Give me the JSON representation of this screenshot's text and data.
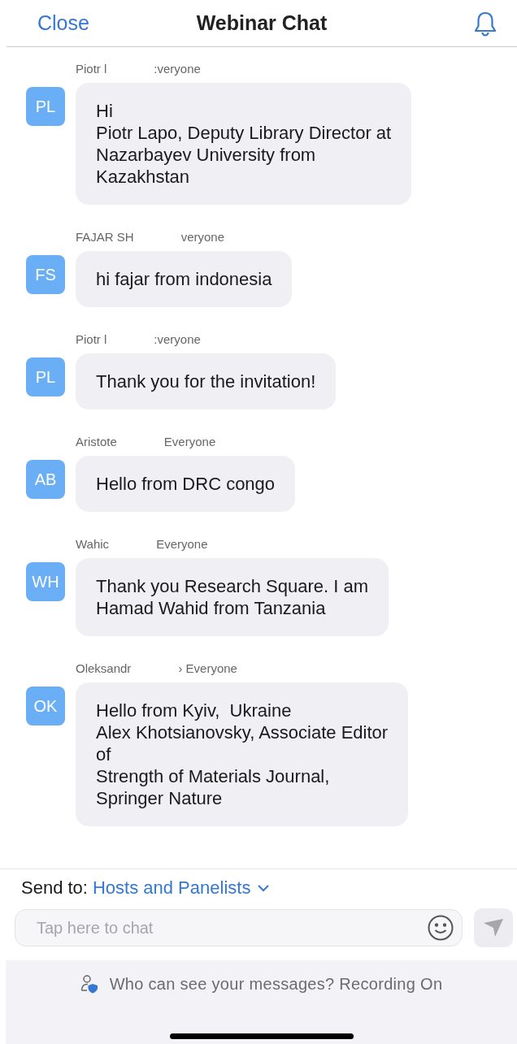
{
  "header": {
    "close": "Close",
    "title": "Webinar Chat"
  },
  "messages": [
    {
      "initials": "PL",
      "sender": "Piotr l",
      "recipient": ":veryone",
      "text": "Hi\nPiotr Lapo, Deputy Library Director at\nNazarbayev University from\nKazakhstan"
    },
    {
      "initials": "FS",
      "sender": "FAJAR SH",
      "recipient": "veryone",
      "text": "hi fajar from indonesia"
    },
    {
      "initials": "PL",
      "sender": "Piotr l",
      "recipient": ":veryone",
      "text": "Thank you for the invitation!"
    },
    {
      "initials": "AB",
      "sender": "Aristote",
      "recipient": "Everyone",
      "text": "Hello from DRC congo"
    },
    {
      "initials": "WH",
      "sender": "Wahic",
      "recipient": "Everyone",
      "text": "Thank you Research Square. I am\nHamad Wahid from Tanzania"
    },
    {
      "initials": "OK",
      "sender": "Oleksandr",
      "recipient": "› Everyone",
      "text": "Hello from Kyiv,  Ukraine\nAlex Khotsianovsky, Associate Editor\nof\nStrength of Materials Journal,\nSpringer Nature"
    }
  ],
  "send_to": {
    "label": "Send to:",
    "value": "Hosts and Panelists"
  },
  "input": {
    "placeholder": "Tap here to chat"
  },
  "footer": {
    "notice": "Who can see your messages? Recording On"
  }
}
